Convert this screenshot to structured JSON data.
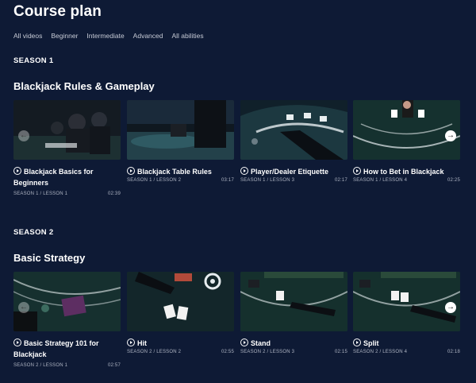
{
  "page": {
    "title": "Course plan"
  },
  "filters": [
    "All videos",
    "Beginner",
    "Intermediate",
    "Advanced",
    "All abilities"
  ],
  "sections": [
    {
      "season": "SEASON 1",
      "title": "Blackjack Rules & Gameplay",
      "cards": [
        {
          "title": "Blackjack Basics for Beginners",
          "lesson": "SEASON 1 / LESSON 1",
          "duration": "02:39"
        },
        {
          "title": "Blackjack Table Rules",
          "lesson": "SEASON 1 / LESSON 2",
          "duration": "03:17"
        },
        {
          "title": "Player/Dealer Etiquette",
          "lesson": "SEASON 1 / LESSON 3",
          "duration": "02:17"
        },
        {
          "title": "How to Bet in Blackjack",
          "lesson": "SEASON 1 / LESSON 4",
          "duration": "02:25"
        }
      ]
    },
    {
      "season": "SEASON 2",
      "title": "Basic Strategy",
      "cards": [
        {
          "title": "Basic Strategy 101 for Blackjack",
          "lesson": "SEASON 2 / LESSON 1",
          "duration": "02:57"
        },
        {
          "title": "Hit",
          "lesson": "SEASON 2 / LESSON 2",
          "duration": "02:55"
        },
        {
          "title": "Stand",
          "lesson": "SEASON 2 / LESSON 3",
          "duration": "02:15"
        },
        {
          "title": "Split",
          "lesson": "SEASON 2 / LESSON 4",
          "duration": "02:18"
        }
      ]
    }
  ],
  "carousel": {
    "prev_icon": "arrow-left-icon",
    "next_icon": "arrow-right-icon",
    "prev_glyph": "←",
    "next_glyph": "→"
  },
  "colors": {
    "background": "#0e1a35",
    "table_felt": "#1f3a3a",
    "text": "#ffffff",
    "meta": "#aeb4c2"
  }
}
